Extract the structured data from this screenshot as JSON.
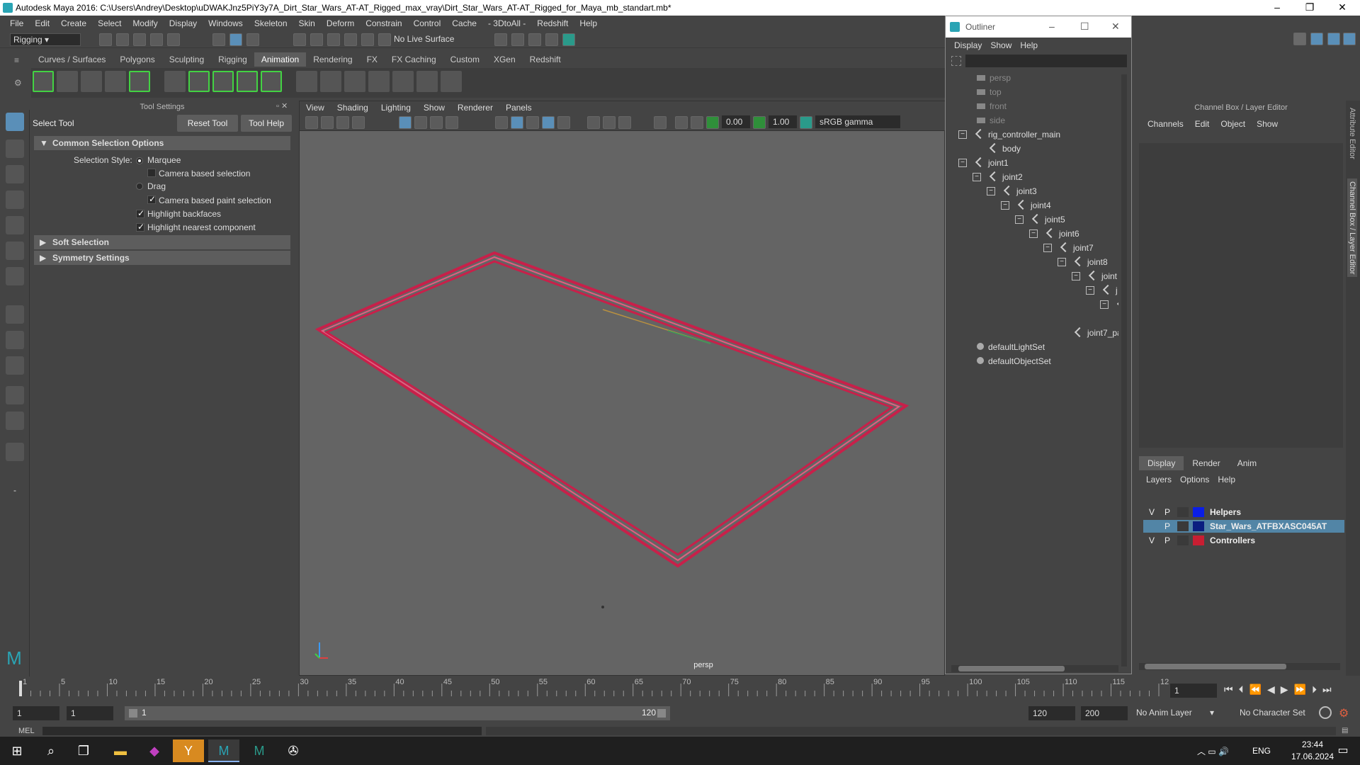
{
  "window": {
    "title": "Autodesk Maya 2016: C:\\Users\\Andrey\\Desktop\\uDWAKJnz5PiY3y7A_Dirt_Star_Wars_AT-AT_Rigged_max_vray\\Dirt_Star_Wars_AT-AT_Rigged_for_Maya_mb_standart.mb*"
  },
  "menubar": [
    "File",
    "Edit",
    "Create",
    "Select",
    "Modify",
    "Display",
    "Windows",
    "Skeleton",
    "Skin",
    "Deform",
    "Constrain",
    "Control",
    "Cache",
    "- 3DtoAll -",
    "Redshift",
    "Help"
  ],
  "statusline": {
    "mode": "Rigging",
    "live_surface": "No Live Surface"
  },
  "shelf_tabs": [
    "Curves / Surfaces",
    "Polygons",
    "Sculpting",
    "Rigging",
    "Animation",
    "Rendering",
    "FX",
    "FX Caching",
    "Custom",
    "XGen",
    "Redshift"
  ],
  "shelf_active": "Animation",
  "tool_settings": {
    "header": "Tool Settings",
    "tool_name": "Select Tool",
    "reset_label": "Reset Tool",
    "help_label": "Tool Help",
    "common_frame": "Common Selection Options",
    "selection_style_label": "Selection Style:",
    "marquee": "Marquee",
    "camera_based": "Camera based selection",
    "drag": "Drag",
    "camera_paint": "Camera based paint selection",
    "highlight_backfaces": "Highlight backfaces",
    "highlight_nearest": "Highlight nearest component",
    "soft_selection": "Soft Selection",
    "symmetry": "Symmetry Settings"
  },
  "viewport": {
    "menus": [
      "View",
      "Shading",
      "Lighting",
      "Show",
      "Renderer",
      "Panels"
    ],
    "value1": "0.00",
    "value2": "1.00",
    "colorspace": "sRGB gamma",
    "camera_label": "persp",
    "frame_color": "#c8204a"
  },
  "outliner": {
    "title": "Outliner",
    "menus": [
      "Display",
      "Show",
      "Help"
    ],
    "nodes": [
      {
        "label": "persp",
        "depth": 0,
        "dim": true
      },
      {
        "label": "top",
        "depth": 0,
        "dim": true
      },
      {
        "label": "front",
        "depth": 0,
        "dim": true
      },
      {
        "label": "side",
        "depth": 0,
        "dim": true
      },
      {
        "label": "rig_controller_main",
        "depth": 0
      },
      {
        "label": "body",
        "depth": 1
      },
      {
        "label": "joint1",
        "depth": 0
      },
      {
        "label": "joint2",
        "depth": 1
      },
      {
        "label": "joint3",
        "depth": 2
      },
      {
        "label": "joint4",
        "depth": 3
      },
      {
        "label": "joint5",
        "depth": 4
      },
      {
        "label": "joint6",
        "depth": 5
      },
      {
        "label": "joint7",
        "depth": 6
      },
      {
        "label": "joint8",
        "depth": 7
      },
      {
        "label": "joint",
        "depth": 8
      },
      {
        "label": "j",
        "depth": 9
      },
      {
        "label": "",
        "depth": 10
      },
      {
        "label": "",
        "depth": 11
      },
      {
        "label": "joint7_pa",
        "depth": 7
      },
      {
        "label": "defaultLightSet",
        "depth": 0
      },
      {
        "label": "defaultObjectSet",
        "depth": 0
      }
    ]
  },
  "channel_box": {
    "header": "Channel Box / Layer Editor",
    "menus": [
      "Channels",
      "Edit",
      "Object",
      "Show"
    ],
    "layer_tabs": [
      "Display",
      "Render",
      "Anim"
    ],
    "layer_menus": [
      "Layers",
      "Options",
      "Help"
    ],
    "layers": [
      {
        "v": "V",
        "p": "P",
        "color": "#0a1ee6",
        "name": "Helpers",
        "selected": false
      },
      {
        "v": "",
        "p": "P",
        "color": "#0a1e80",
        "name": "Star_Wars_ATFBXASC045AT",
        "selected": true
      },
      {
        "v": "V",
        "p": "P",
        "color": "#c81e32",
        "name": "Controllers",
        "selected": false
      }
    ],
    "side_tabs": [
      "Attribute Editor",
      "Channel Box / Layer Editor"
    ]
  },
  "timeline": {
    "ticks": [
      "1",
      "5",
      "10",
      "15",
      "20",
      "25",
      "30",
      "35",
      "40",
      "45",
      "50",
      "55",
      "60",
      "65",
      "70",
      "75",
      "80",
      "85",
      "90",
      "95",
      "100",
      "105",
      "110",
      "115",
      "120"
    ],
    "current_frame": "1"
  },
  "range": {
    "start": "1",
    "playback_start": "1",
    "slider_start": "1",
    "slider_end": "120",
    "playback_end": "120",
    "end": "200",
    "anim_layer": "No Anim Layer",
    "char_set": "No Character Set"
  },
  "cmdline": {
    "label": "MEL"
  },
  "taskbar": {
    "lang": "ENG",
    "time": "23:44",
    "date": "17.06.2024"
  }
}
